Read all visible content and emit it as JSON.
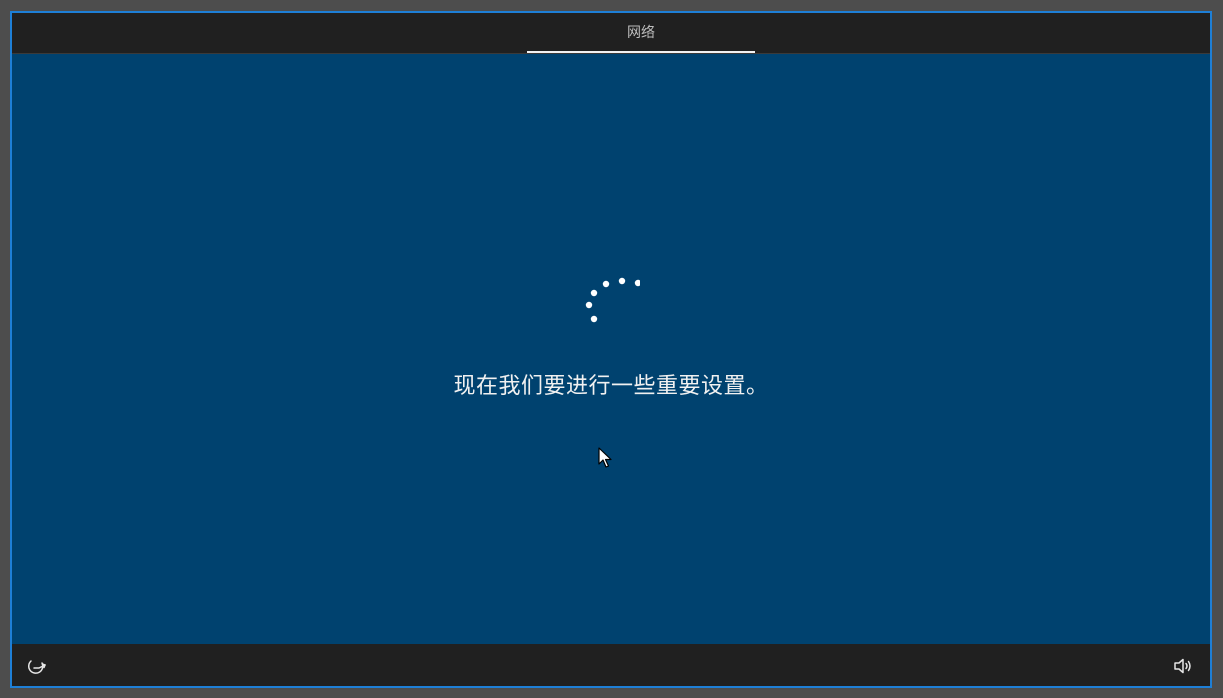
{
  "window": {
    "border_color": "#1e7fd6",
    "background_color": "#00426f"
  },
  "topbar": {
    "tabs": [
      {
        "label": "网络",
        "active": true
      }
    ]
  },
  "main": {
    "message": "现在我们要进行一些重要设置。",
    "spinner_icon": "loading-dots-icon"
  },
  "bottombar": {
    "left_icon": "ease-of-access-icon",
    "right_icon": "volume-icon"
  }
}
